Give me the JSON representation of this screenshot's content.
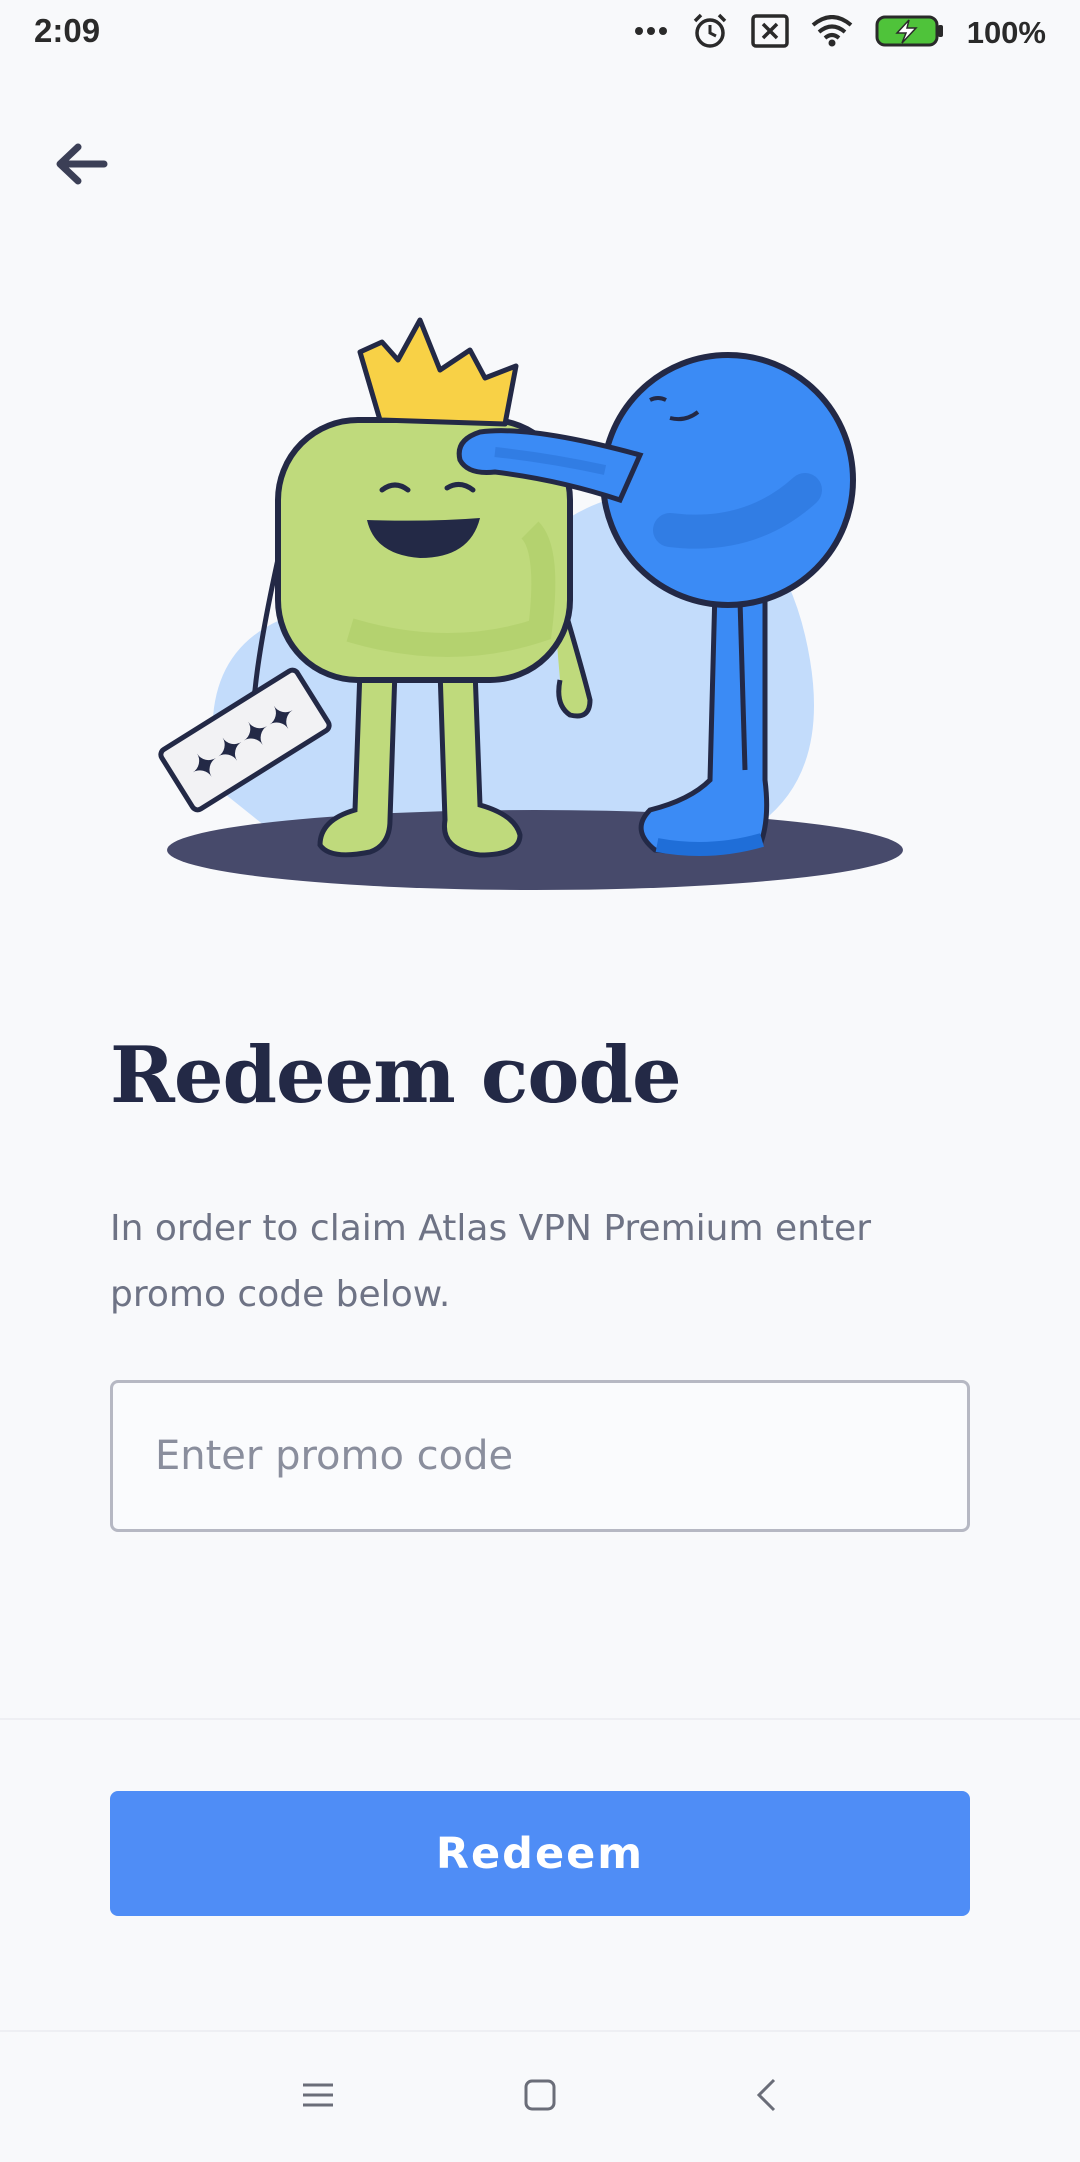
{
  "status_bar": {
    "time": "2:09",
    "battery_percent": "100%",
    "icons": [
      "more-dots-icon",
      "alarm-icon",
      "sim-error-icon",
      "wifi-icon",
      "battery-charging-icon"
    ]
  },
  "header": {
    "back_icon": "arrow-left-icon"
  },
  "illustration": {
    "description_icon": "mascots-illustration"
  },
  "main": {
    "title": "Redeem code",
    "description": "In order to claim Atlas VPN Premium enter promo code below.",
    "promo_input": {
      "value": "",
      "placeholder": "Enter promo code"
    }
  },
  "footer": {
    "redeem_label": "Redeem"
  },
  "nav_bar": {
    "icons": [
      "menu-icon",
      "home-square-icon",
      "back-chevron-icon"
    ]
  },
  "colors": {
    "accent": "#4f8df6",
    "title": "#232946",
    "text_secondary": "#6e7385",
    "background": "#f8f9fb"
  }
}
